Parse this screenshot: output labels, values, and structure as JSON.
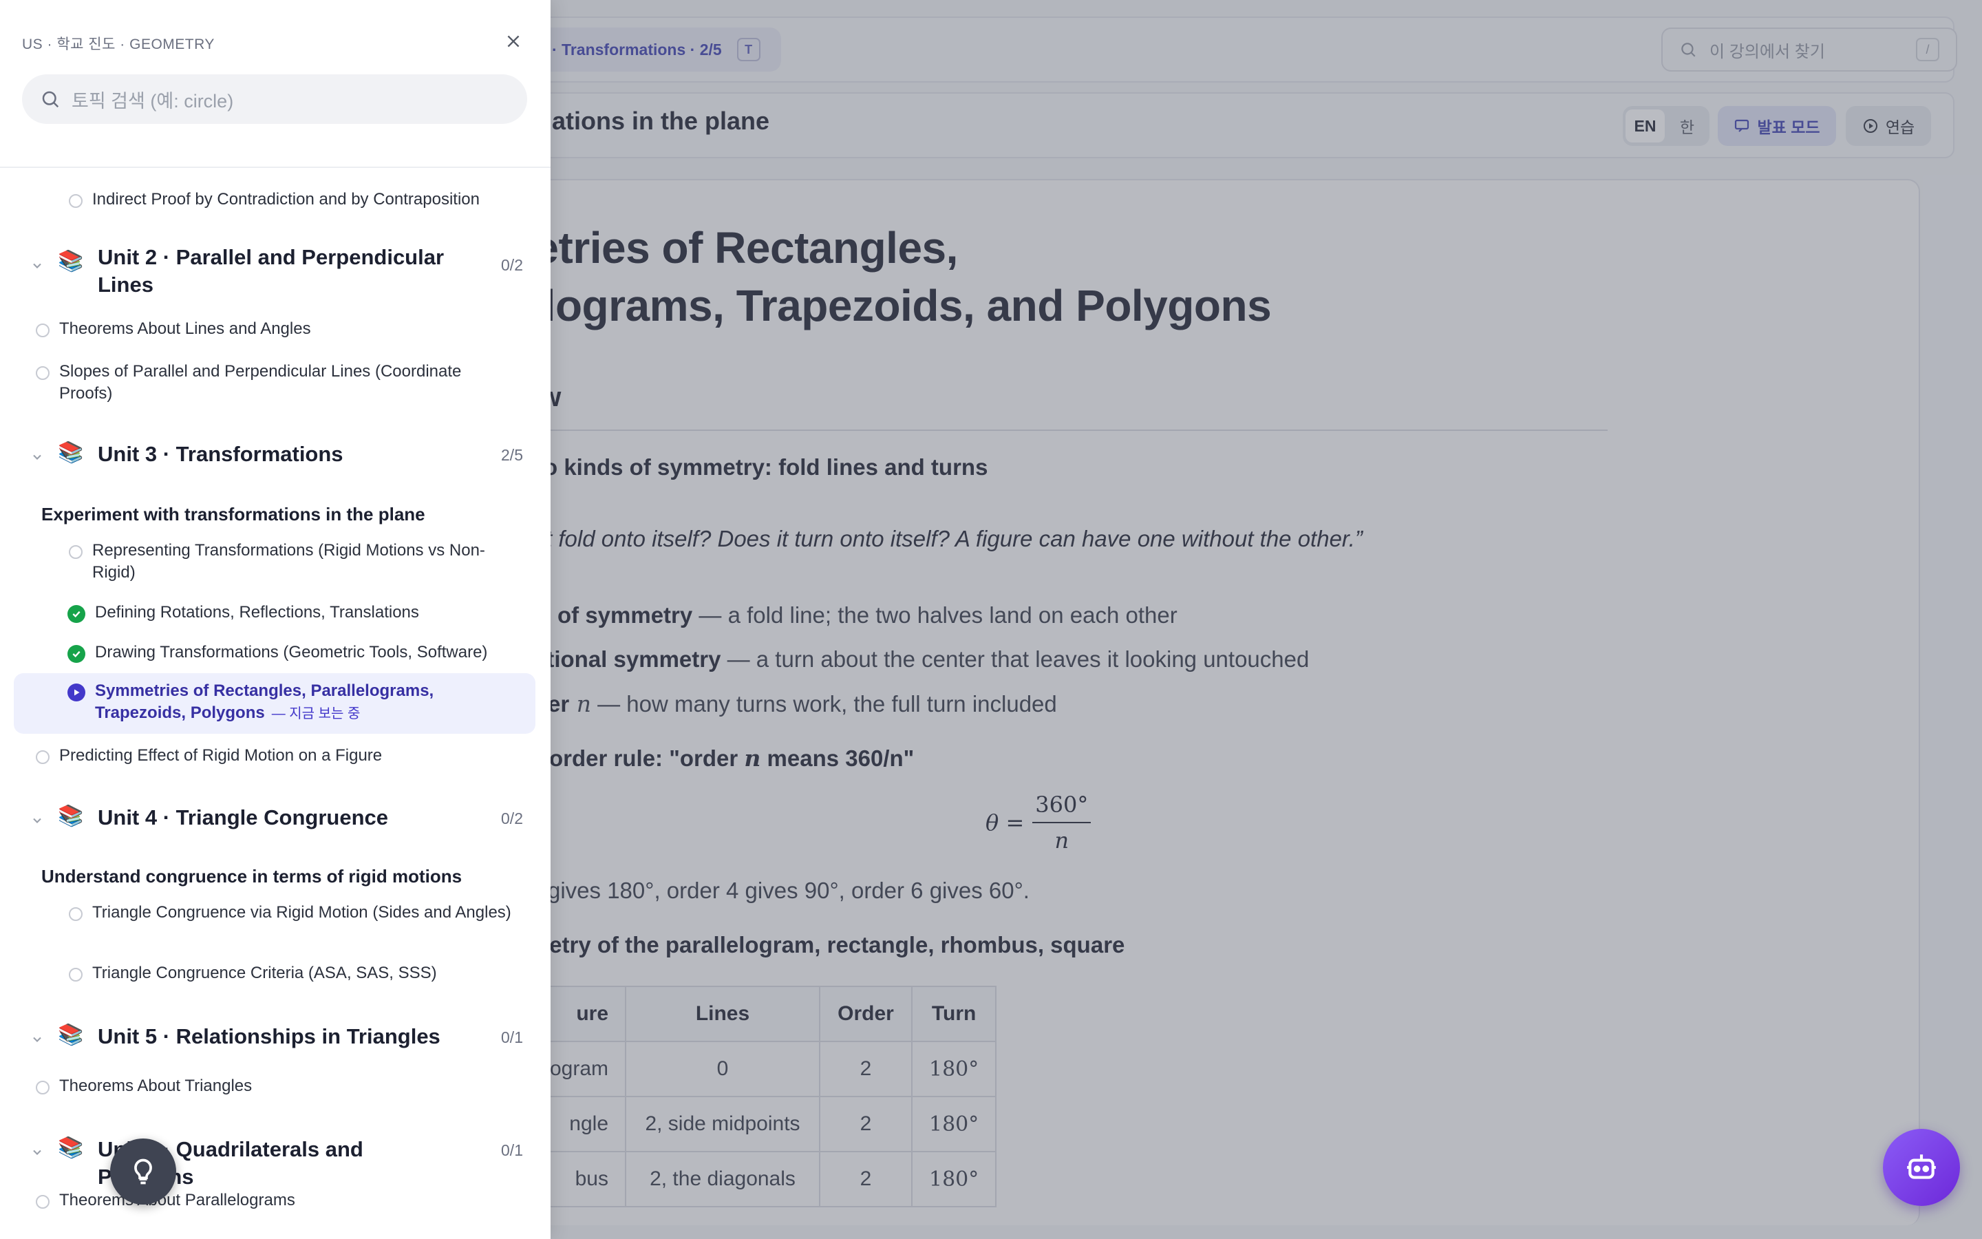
{
  "topbar": {
    "breadcrumb_chip": "· Transformations · 2/5",
    "breadcrumb_key": "T",
    "search_placeholder": "이 강의에서 찾기",
    "search_key": "/"
  },
  "header": {
    "title": "nations in the plane",
    "lang_en": "EN",
    "lang_ko": "한",
    "present_label": "발표 모드",
    "practice_label": "연습"
  },
  "doc": {
    "title_line1": "metries of Rectangles,",
    "title_line2": "llelograms, Trapezoids, and Polygons",
    "h2": "ew",
    "h3_kinds": "o kinds of symmetry: fold lines and turns",
    "quote": "s it fold onto itself? Does it turn onto itself? A figure can have one without the other.”",
    "li1_bold": "of symmetry",
    "li1_rest": " — a fold line; the two halves land on each other",
    "li2_bold": "ational symmetry",
    "li2_rest": " — a turn about the center that leaves it looking untouched",
    "li3_bold": "er",
    "li3_var": " n",
    "li3_rest": " — how many turns work, the full turn included",
    "h3_rule_pre": "order rule: \"order ",
    "h3_rule_var": "n",
    "h3_rule_post": " means 360/n\"",
    "formula_lhs": "θ =",
    "formula_num": "360°",
    "formula_den": "n",
    "gives_line": "gives 180°, order 4 gives 90°, order 6 gives 60°.",
    "h3_table": "netry of the parallelogram, rectangle, rhombus, square",
    "table": {
      "headers": [
        "ure",
        "Lines",
        "Order",
        "Turn"
      ],
      "rows": [
        [
          "ogram",
          "0",
          "2",
          "180°"
        ],
        [
          "ngle",
          "2, side midpoints",
          "2",
          "180°"
        ],
        [
          "bus",
          "2, the diagonals",
          "2",
          "180°"
        ]
      ]
    }
  },
  "drawer": {
    "crumb": "US · 학교 진도 · GEOMETRY",
    "search_placeholder": "토픽 검색 (예: circle)",
    "top_item": "Indirect Proof by Contradiction and by Contraposition",
    "unit2": {
      "title": "Unit 2 · Parallel and Perpendicular Lines",
      "count": "0/2",
      "items": [
        "Theorems About Lines and Angles",
        "Slopes of Parallel and Perpendicular Lines (Coordinate Proofs)"
      ]
    },
    "unit3": {
      "title": "Unit 3 · Transformations",
      "count": "2/5",
      "sub_head": "Experiment with transformations in the plane",
      "items": [
        "Representing Transformations (Rigid Motions vs Non-Rigid)",
        "Defining Rotations, Reflections, Translations",
        "Drawing Transformations (Geometric Tools, Software)",
        "Symmetries of Rectangles, Parallelograms, Trapezoids, Polygons",
        "Predicting Effect of Rigid Motion on a Figure"
      ],
      "now_tag": "— 지금 보는 중"
    },
    "unit4": {
      "title": "Unit 4 · Triangle Congruence",
      "count": "0/2",
      "sub_head": "Understand congruence in terms of rigid motions",
      "items": [
        "Triangle Congruence via Rigid Motion (Sides and Angles)",
        "Triangle Congruence Criteria (ASA, SAS, SSS)"
      ]
    },
    "unit5": {
      "title": "Unit 5 · Relationships in Triangles",
      "count": "0/1",
      "items": [
        "Theorems About Triangles"
      ]
    },
    "unit6": {
      "title": "Unit 6 · Quadrilaterals and Polygons",
      "count": "0/1",
      "items": [
        "Theorems About Parallelograms"
      ]
    }
  },
  "colors": {
    "accent": "#4338ca",
    "done": "#16a34a",
    "assistant": "#7c3aed"
  }
}
